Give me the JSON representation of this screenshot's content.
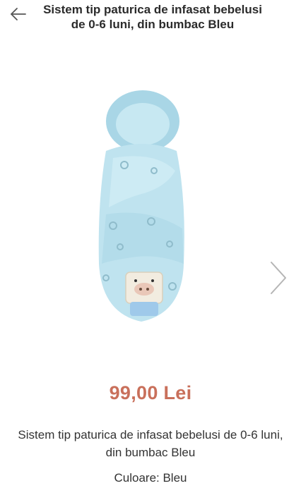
{
  "header": {
    "title": "Sistem tip paturica de infasat bebelusi de 0-6 luni, din bumbac Bleu",
    "back_icon": "arrow-left-icon"
  },
  "gallery": {
    "next_icon": "chevron-right-icon",
    "image_colors": {
      "fabric": "#bfe3ef",
      "fabric_shadow": "#9fcfe0",
      "pig_face": "#f2ece0"
    }
  },
  "product": {
    "price": "99,00 Lei",
    "name": "Sistem tip paturica de infasat bebelusi de 0-6 luni, din bumbac Bleu",
    "color": "Culoare: Bleu"
  },
  "colors": {
    "price": "#c9705b",
    "text": "#333333"
  }
}
